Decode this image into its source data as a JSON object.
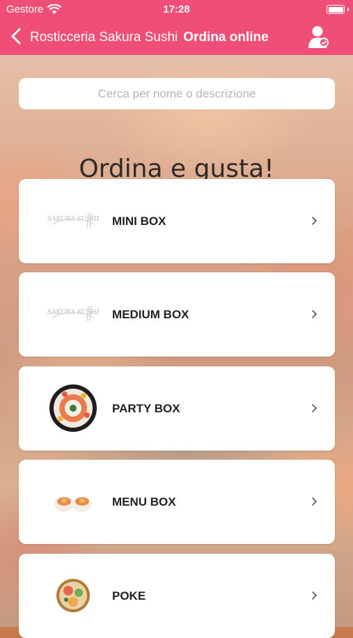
{
  "status_bar": {
    "carrier": "Gestore",
    "time": "17:28"
  },
  "nav": {
    "title": "Rosticceria Sakura Sushi",
    "subtitle": "Ordina online"
  },
  "search": {
    "placeholder": "Cerca per nome o descrizione"
  },
  "heading": "Ordina e gusta!",
  "logo_text": "SAKURA SUSHI",
  "categories": [
    {
      "label": "MINI BOX",
      "image": "sakura-logo"
    },
    {
      "label": "MEDIUM BOX",
      "image": "sakura-logo"
    },
    {
      "label": "PARTY BOX",
      "image": "sushi-platter"
    },
    {
      "label": "MENU BOX",
      "image": "sushi-rolls"
    },
    {
      "label": "POKE",
      "image": "poke-bowl"
    }
  ],
  "colors": {
    "accent": "#ef4f77",
    "card": "#ffffff",
    "text": "#222222"
  }
}
